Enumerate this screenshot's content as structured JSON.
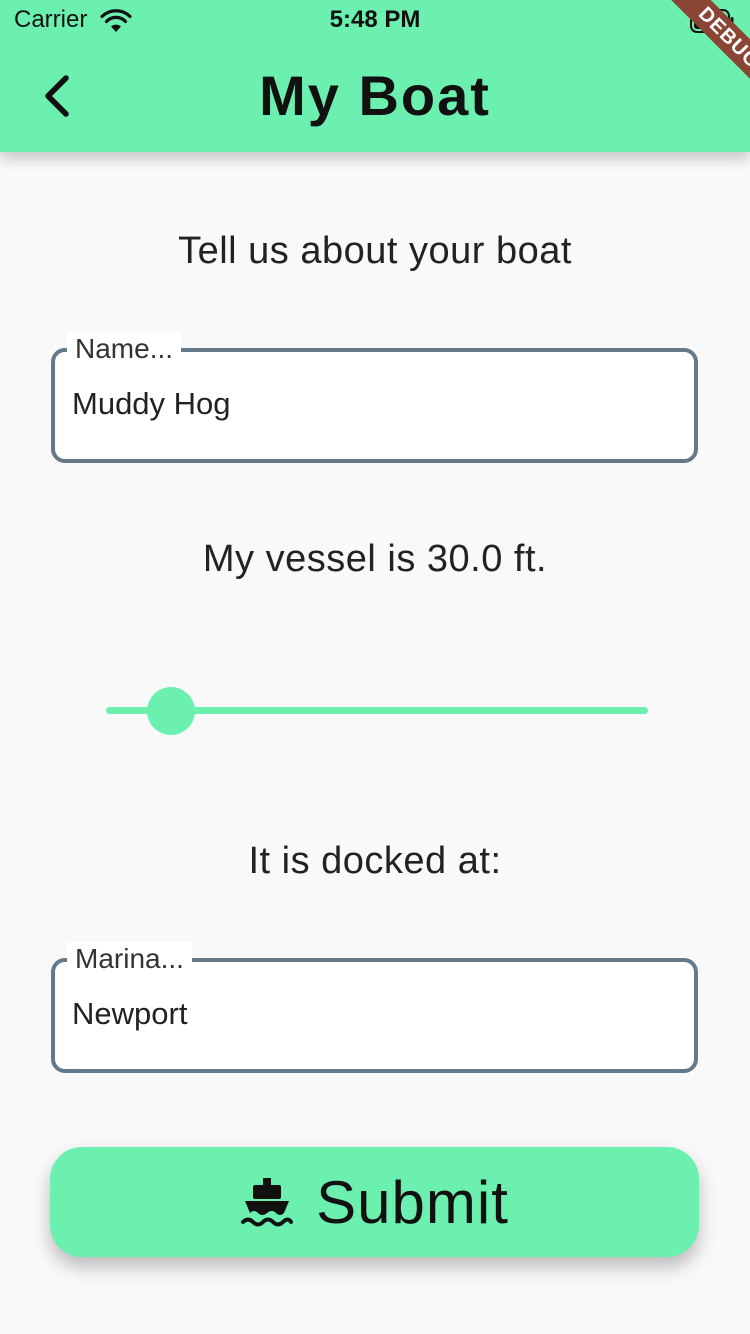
{
  "status_bar": {
    "carrier": "Carrier",
    "time": "5:48 PM"
  },
  "app_bar": {
    "title": "My Boat",
    "debug_banner": "DEBUG"
  },
  "form": {
    "intro": "Tell us about your boat",
    "name_field": {
      "label": "Name...",
      "value": "Muddy Hog"
    },
    "length_text": "My vessel is 30.0 ft.",
    "length_slider": {
      "value_fraction": 0.12
    },
    "dock_text": "It is docked at:",
    "marina_field": {
      "label": "Marina...",
      "value": "Newport"
    },
    "submit": {
      "label": "Submit",
      "icon": "ship-icon"
    }
  },
  "colors": {
    "accent": "#6cf0b0",
    "field_border": "#64798a",
    "background": "#f9f9f9",
    "debug_ribbon": "#8b4534"
  }
}
